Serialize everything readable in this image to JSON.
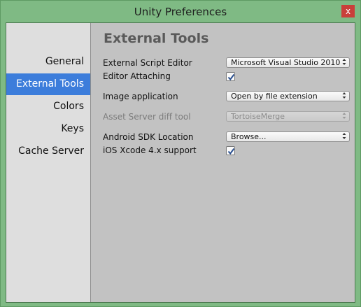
{
  "window": {
    "title": "Unity Preferences",
    "close_glyph": "x"
  },
  "sidebar": {
    "items": [
      {
        "label": "General"
      },
      {
        "label": "External Tools",
        "active": true
      },
      {
        "label": "Colors"
      },
      {
        "label": "Keys"
      },
      {
        "label": "Cache Server"
      }
    ]
  },
  "content": {
    "heading": "External Tools",
    "external_script_editor": {
      "label": "External Script Editor",
      "value": "Microsoft Visual Studio 2010"
    },
    "editor_attaching": {
      "label": "Editor Attaching",
      "checked": true
    },
    "image_application": {
      "label": "Image application",
      "value": "Open by file extension"
    },
    "asset_server_diff": {
      "label": "Asset Server diff tool",
      "value": "TortoiseMerge",
      "disabled": true
    },
    "android_sdk": {
      "label": "Android SDK Location",
      "value": "Browse..."
    },
    "ios_xcode": {
      "label": "iOS Xcode 4.x support",
      "checked": true
    }
  },
  "colors": {
    "window_frame": "#7fba84",
    "selection": "#3c7ddb",
    "close_button": "#c9403a",
    "checkmark": "#2a4f8f"
  },
  "icons": {
    "close": "close-icon",
    "dropdown_arrow": "chevron-updown-icon",
    "check": "checkmark-icon"
  }
}
